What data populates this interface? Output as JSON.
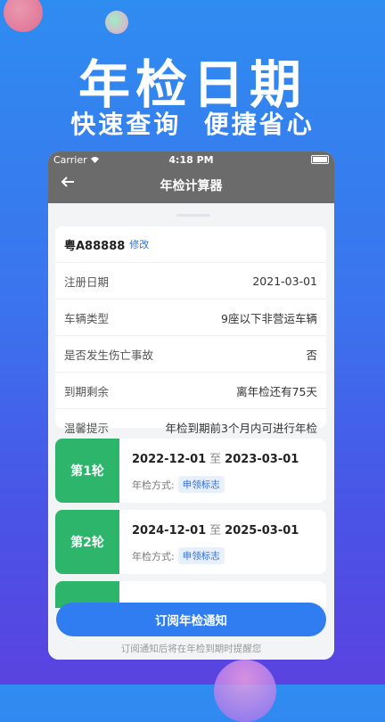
{
  "hero": {
    "title": "年检日期",
    "subtitle": "快速查询  便捷省心"
  },
  "statusbar": {
    "carrier": "Carrier",
    "time": "4:18 PM"
  },
  "navbar": {
    "title": "年检计算器"
  },
  "info_card": {
    "plate": "粤A88888",
    "edit_label": "修改",
    "rows": [
      {
        "label": "注册日期",
        "value": "2021-03-01"
      },
      {
        "label": "车辆类型",
        "value": "9座以下非营运车辆"
      },
      {
        "label": "是否发生伤亡事故",
        "value": "否"
      },
      {
        "label": "到期剩余",
        "value": "离年检还有75天"
      },
      {
        "label": "温馨提示",
        "value": "年检到期前3个月内可进行年检"
      }
    ]
  },
  "rounds": [
    {
      "tag": "第1轮",
      "start": "2022-12-01",
      "sep": "至",
      "end": "2023-03-01",
      "method_label": "年检方式:",
      "method": "申领标志"
    },
    {
      "tag": "第2轮",
      "start": "2024-12-01",
      "sep": "至",
      "end": "2025-03-01",
      "method_label": "年检方式:",
      "method": "申领标志"
    }
  ],
  "subscribe": {
    "button_label": "订阅年检通知",
    "footnote": "订阅通知后将在年检到期时提醒您"
  },
  "colors": {
    "accent": "#2f7df1",
    "round_tag": "#2db56b",
    "navbar": "#6b6b6b"
  }
}
